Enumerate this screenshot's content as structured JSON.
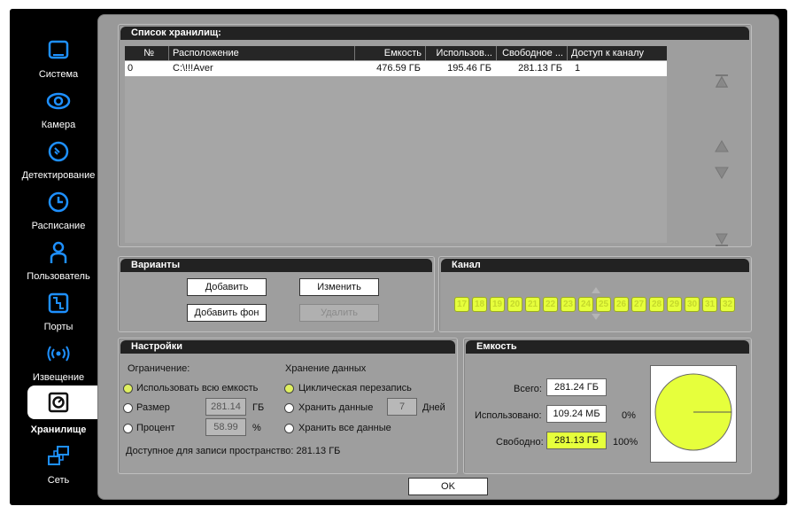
{
  "sidebar": {
    "items": [
      {
        "label": "Система",
        "icon": "monitor-icon"
      },
      {
        "label": "Камера",
        "icon": "eye-icon"
      },
      {
        "label": "Детектирование",
        "icon": "motion-detect-icon"
      },
      {
        "label": "Расписание",
        "icon": "clock-icon"
      },
      {
        "label": "Пользователь",
        "icon": "user-icon"
      },
      {
        "label": "Порты",
        "icon": "port-icon"
      },
      {
        "label": "Извещение",
        "icon": "broadcast-icon"
      },
      {
        "label": "Хранилище",
        "icon": "storage-icon"
      },
      {
        "label": "Сеть",
        "icon": "network-icon"
      }
    ],
    "active_index": 7
  },
  "storage_list": {
    "title": "Список хранилищ:",
    "columns": [
      "№",
      "Расположение",
      "Емкость",
      "Использов...",
      "Свободное ...",
      "Доступ к каналу"
    ],
    "rows": [
      {
        "num": "0",
        "location": "C:\\!!!Aver",
        "capacity": "476.59 ГБ",
        "used": "195.46 ГБ",
        "free": "281.13 ГБ",
        "access": "1"
      }
    ]
  },
  "options": {
    "title": "Варианты",
    "add_label": "Добавить",
    "edit_label": "Изменить",
    "add_bg_label": "Добавить фон",
    "delete_label": "Удалить"
  },
  "channel": {
    "title": "Канал",
    "channels": [
      "17",
      "18",
      "19",
      "20",
      "21",
      "22",
      "23",
      "24",
      "25",
      "26",
      "27",
      "28",
      "29",
      "30",
      "31",
      "32"
    ]
  },
  "settings": {
    "title": "Настройки",
    "limit_label": "Ограничение:",
    "use_all": "Использовать всю емкость",
    "size_label": "Размер",
    "size_value": "281.14",
    "size_unit": "ГБ",
    "percent_label": "Процент",
    "percent_value": "58.99",
    "percent_unit": "%",
    "storage_label": "Хранение данных",
    "cyclic": "Циклическая перезапись",
    "keep_data": "Хранить данные",
    "days_value": "7",
    "days_unit": "Дней",
    "keep_all": "Хранить все данные",
    "available": "Доступное для записи пространство: 281.13 ГБ"
  },
  "capacity": {
    "title": "Емкость",
    "total_label": "Всего:",
    "total_value": "281.24 ГБ",
    "used_label": "Использовано:",
    "used_value": "109.24 МБ",
    "used_pct": "0%",
    "free_label": "Свободно:",
    "free_value": "281.13 ГБ",
    "free_pct": "100%"
  },
  "footer": {
    "ok_label": "OK"
  },
  "colors": {
    "accent_green": "#e6ff3c",
    "panel": "#999999"
  }
}
